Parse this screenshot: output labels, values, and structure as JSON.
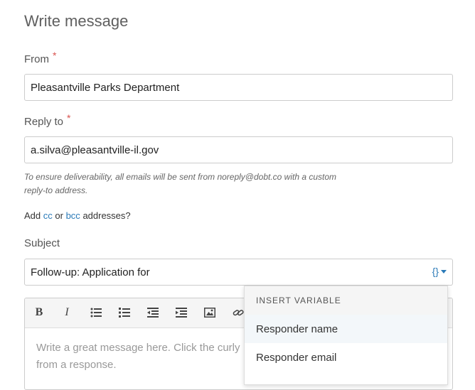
{
  "page": {
    "title": "Write message"
  },
  "from": {
    "label": "From",
    "required_mark": "*",
    "value": "Pleasantville Parks Department"
  },
  "reply_to": {
    "label": "Reply to",
    "required_mark": "*",
    "value": "a.silva@pleasantville-il.gov",
    "help_text_line1": "To ensure deliverability, all emails will be sent from noreply@dobt.co with a custom",
    "help_text_line2": "reply-to address."
  },
  "cc_bcc": {
    "prefix": "Add",
    "cc": "cc",
    "or": "or",
    "bcc": "bcc",
    "suffix": "addresses?"
  },
  "subject": {
    "label": "Subject",
    "value": "Follow-up: Application for",
    "variable_button": "{}"
  },
  "editor": {
    "toolbar": [
      "bold",
      "italic",
      "bulleted-list",
      "numbered-list",
      "outdent",
      "indent",
      "image",
      "link"
    ],
    "bold_label": "B",
    "italic_label": "I",
    "placeholder_line1": "Write a great message here. Click the curly",
    "placeholder_line2": "from a response."
  },
  "insert_variable": {
    "header": "INSERT VARIABLE",
    "items": [
      "Responder name",
      "Responder email"
    ]
  },
  "colors": {
    "link": "#2a7ab8",
    "required": "#d9534f",
    "placeholder": "#999999"
  }
}
